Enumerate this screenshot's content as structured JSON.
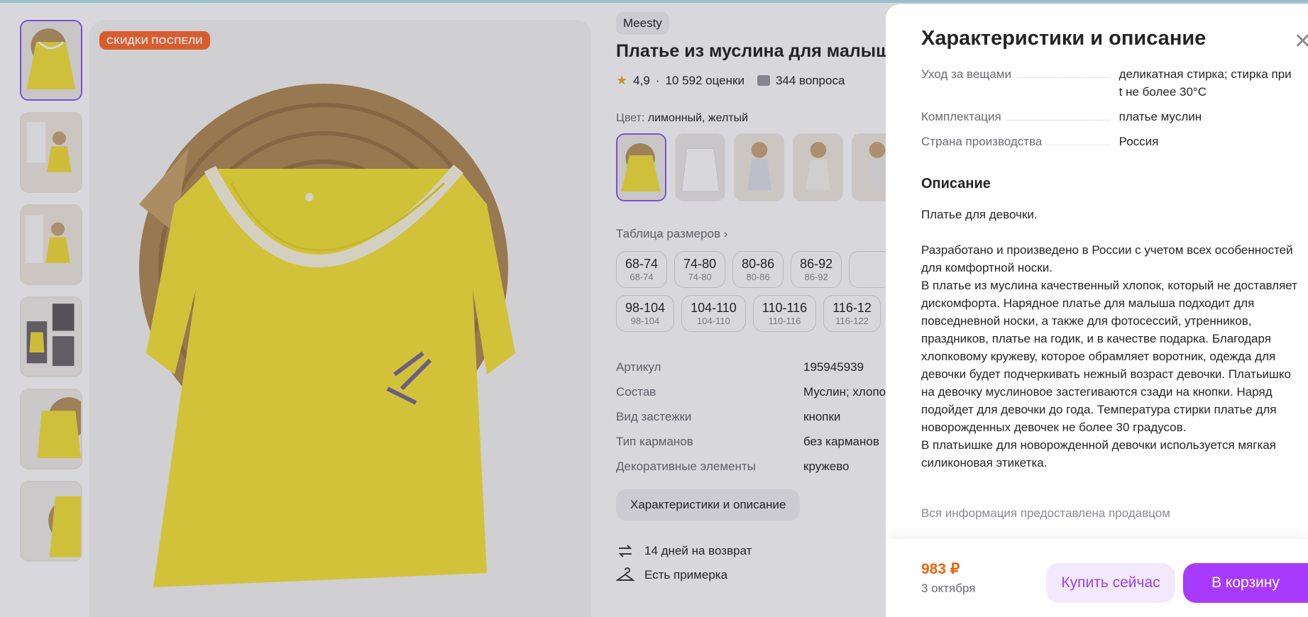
{
  "product": {
    "sale_badge": "СКИДКИ ПОСПЕЛИ",
    "brand": "Meesty",
    "title": "Платье из муслина для малыше",
    "rating": "4,9",
    "rating_sep": "·",
    "reviews": "10 592 оценки",
    "questions": "344 вопроса",
    "color_label": "Цвет:",
    "color_value": "лимонный, желтый",
    "size_table_link": "Таблица размеров ›",
    "sizes": [
      {
        "main": "68-74",
        "sub": "68-74"
      },
      {
        "main": "74-80",
        "sub": "74-80"
      },
      {
        "main": "80-86",
        "sub": "80-86"
      },
      {
        "main": "86-92",
        "sub": "86-92"
      },
      {
        "main": "",
        "sub": ""
      },
      {
        "main": "98-104",
        "sub": "98-104"
      },
      {
        "main": "104-110",
        "sub": "104-110"
      },
      {
        "main": "110-116",
        "sub": "110-116"
      },
      {
        "main": "116-12",
        "sub": "116-122"
      }
    ],
    "props": [
      {
        "name": "Артикул",
        "value": "195945939"
      },
      {
        "name": "Состав",
        "value": "Муслин; хлопо"
      },
      {
        "name": "Вид застежки",
        "value": "кнопки"
      },
      {
        "name": "Тип карманов",
        "value": "без карманов"
      },
      {
        "name": "Декоративные элементы",
        "value": "кружево"
      }
    ],
    "specs_button": "Характеристики и описание",
    "return_text": "14 дней на возврат",
    "fitting_text": "Есть примерка"
  },
  "drawer": {
    "title": "Характеристики и описание",
    "close_icon": "✕",
    "props": [
      {
        "name": "Уход за вещами",
        "value": "деликатная стирка; стирка при t не более 30°C"
      },
      {
        "name": "Комплектация",
        "value": "платье муслин"
      },
      {
        "name": "Страна производства",
        "value": "Россия"
      }
    ],
    "description_heading": "Описание",
    "description": "Платье для девочки.\n\nРазработано и произведено в России с учетом всех особенностей для комфортной носки.\nВ платье из муслина качественный хлопок, который не доставляет дискомфорта. Нарядное платье для малыша подходит для повседневной носки, а также для фотосессий, утренников, праздников, платье на годик, и в качестве подарка. Благодаря хлопковому кружеву, которое обрамляет воротник, одежда для девочки будет подчеркивать нежный возраст девочки. Платьишко на девочку муслиновое застегиваются сзади на кнопки. Наряд подойдет для девочки до года. Температура стирки платье для новорожденных девочек не более 30 градусов.\nВ платьишке для новорожденной девочки используется мягкая силиконовая этикетка.",
    "seller_note": "Вся информация предоставлена продавцом",
    "price": "983 ₽",
    "delivery_date": "3 октября",
    "buy_now_label": "Купить сейчас",
    "add_to_cart_label": "В корзину"
  },
  "colors": {
    "accent": "#a73afd",
    "price": "#e8650e",
    "badge": "#ff6a2b",
    "dress": "#f6e33a"
  }
}
